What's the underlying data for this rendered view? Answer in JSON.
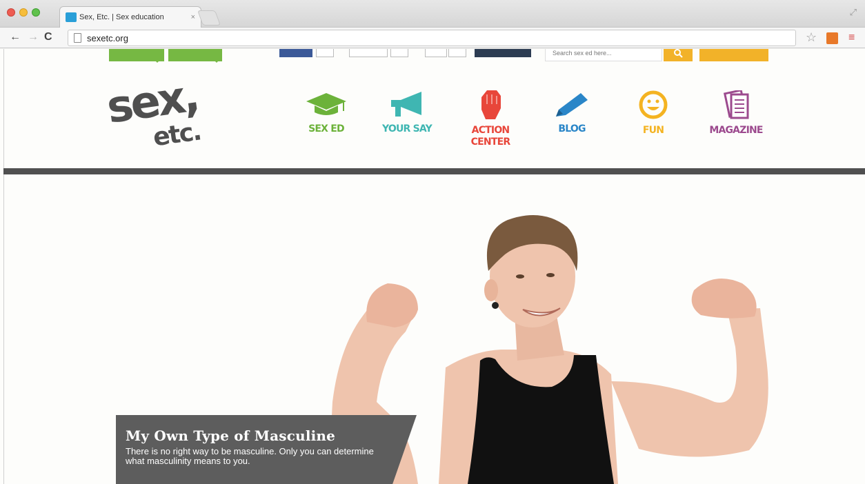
{
  "browser": {
    "tab_title": "Sex, Etc. | Sex education",
    "tab_close": "×",
    "url": "sexetc.org"
  },
  "utility": {
    "search_placeholder": "Search sex ed here..."
  },
  "logo": {
    "main": "sex,",
    "sub": "etc."
  },
  "nav": [
    {
      "label": "SEX ED",
      "icon": "graduation-cap-icon",
      "color": "#6cb23a"
    },
    {
      "label": "YOUR SAY",
      "icon": "megaphone-icon",
      "color": "#3fb6b2"
    },
    {
      "label": "ACTION CENTER",
      "icon": "raised-fist-icon",
      "color": "#e8463a"
    },
    {
      "label": "BLOG",
      "icon": "pencil-icon",
      "color": "#2a86c8"
    },
    {
      "label": "FUN",
      "icon": "smiley-icon",
      "color": "#f4b321"
    },
    {
      "label": "MAGAZINE",
      "icon": "magazine-icon",
      "color": "#9c4a8e"
    }
  ],
  "hero": {
    "title": "My Own Type of Masculine",
    "text": "There is no right way to be masculine. Only you can determine what masculinity means to you."
  }
}
